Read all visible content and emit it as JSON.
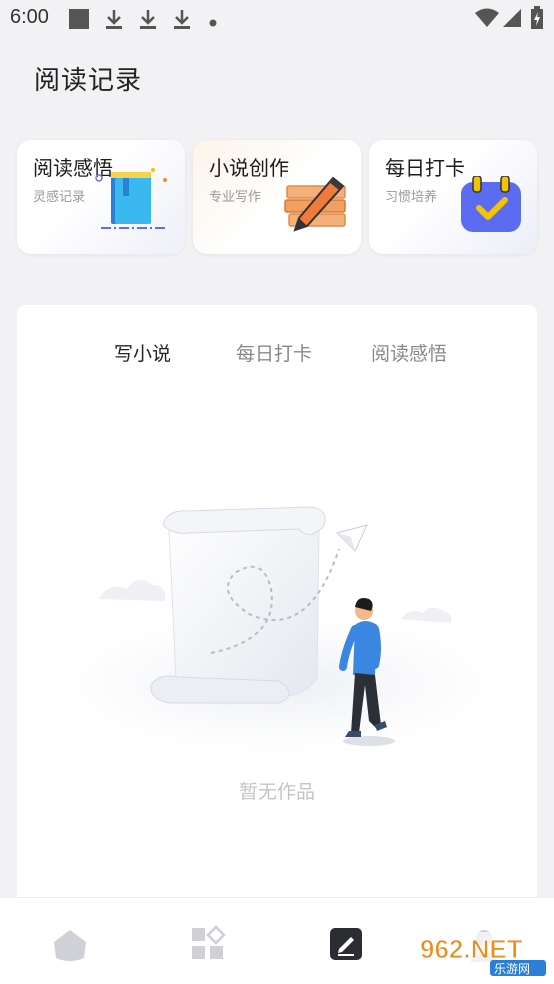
{
  "status_bar": {
    "time": "6:00",
    "icons": [
      "square-icon",
      "download-icon",
      "download-icon",
      "download-icon",
      "dot-icon",
      "wifi-icon",
      "signal-icon",
      "battery-icon"
    ]
  },
  "header": {
    "title": "阅读记录"
  },
  "cards": [
    {
      "title": "阅读感悟",
      "subtitle": "灵感记录",
      "icon": "book-icon"
    },
    {
      "title": "小说创作",
      "subtitle": "专业写作",
      "icon": "pencil-books-icon"
    },
    {
      "title": "每日打卡",
      "subtitle": "习惯培养",
      "icon": "calendar-check-icon"
    }
  ],
  "tabs": [
    {
      "label": "写小说",
      "active": true
    },
    {
      "label": "每日打卡",
      "active": false
    },
    {
      "label": "阅读感悟",
      "active": false
    }
  ],
  "empty_state": {
    "text": "暂无作品",
    "illustration": "scroll-person-illustration"
  },
  "bottom_nav": [
    {
      "name": "home",
      "icon": "home-icon",
      "active": false
    },
    {
      "name": "apps",
      "icon": "apps-icon",
      "active": false
    },
    {
      "name": "write",
      "icon": "edit-icon",
      "active": true
    },
    {
      "name": "profile",
      "icon": "person-icon",
      "active": false
    }
  ],
  "watermark": {
    "text_main": "962.NET",
    "text_sub": "乐游网"
  },
  "colors": {
    "accent_blue": "#5b6cf0",
    "text_dark": "#222222",
    "text_muted": "#999999"
  }
}
